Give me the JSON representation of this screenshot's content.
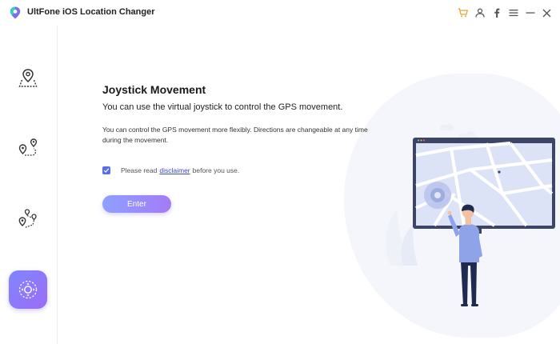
{
  "app": {
    "title": "UltFone iOS Location Changer"
  },
  "titlebar": {
    "icons": [
      "cart-icon",
      "user-icon",
      "facebook-icon",
      "menu-icon",
      "minimize-icon",
      "close-icon"
    ]
  },
  "sidebar": {
    "items": [
      {
        "name": "change-location",
        "icon": "map-pin-icon",
        "active": false
      },
      {
        "name": "two-spot-movement",
        "icon": "two-spot-route-icon",
        "active": false
      },
      {
        "name": "multi-spot-movement",
        "icon": "multi-spot-route-icon",
        "active": false
      },
      {
        "name": "joystick-movement",
        "icon": "joystick-icon",
        "active": true
      }
    ]
  },
  "main": {
    "title": "Joystick Movement",
    "subtitle": "You can use the virtual joystick to control the GPS movement.",
    "description": "You can control the GPS movement more flexibly. Directions are changeable at any time during the movement.",
    "disclaimer": {
      "checked": true,
      "prefix": "Please read",
      "link": "disclaimer",
      "suffix": "before you use."
    },
    "enter_label": "Enter"
  },
  "colors": {
    "accent": "#8f80f7",
    "checkbox": "#5b6ee8",
    "link": "#3d49b0",
    "cart": "#e8a23a"
  }
}
